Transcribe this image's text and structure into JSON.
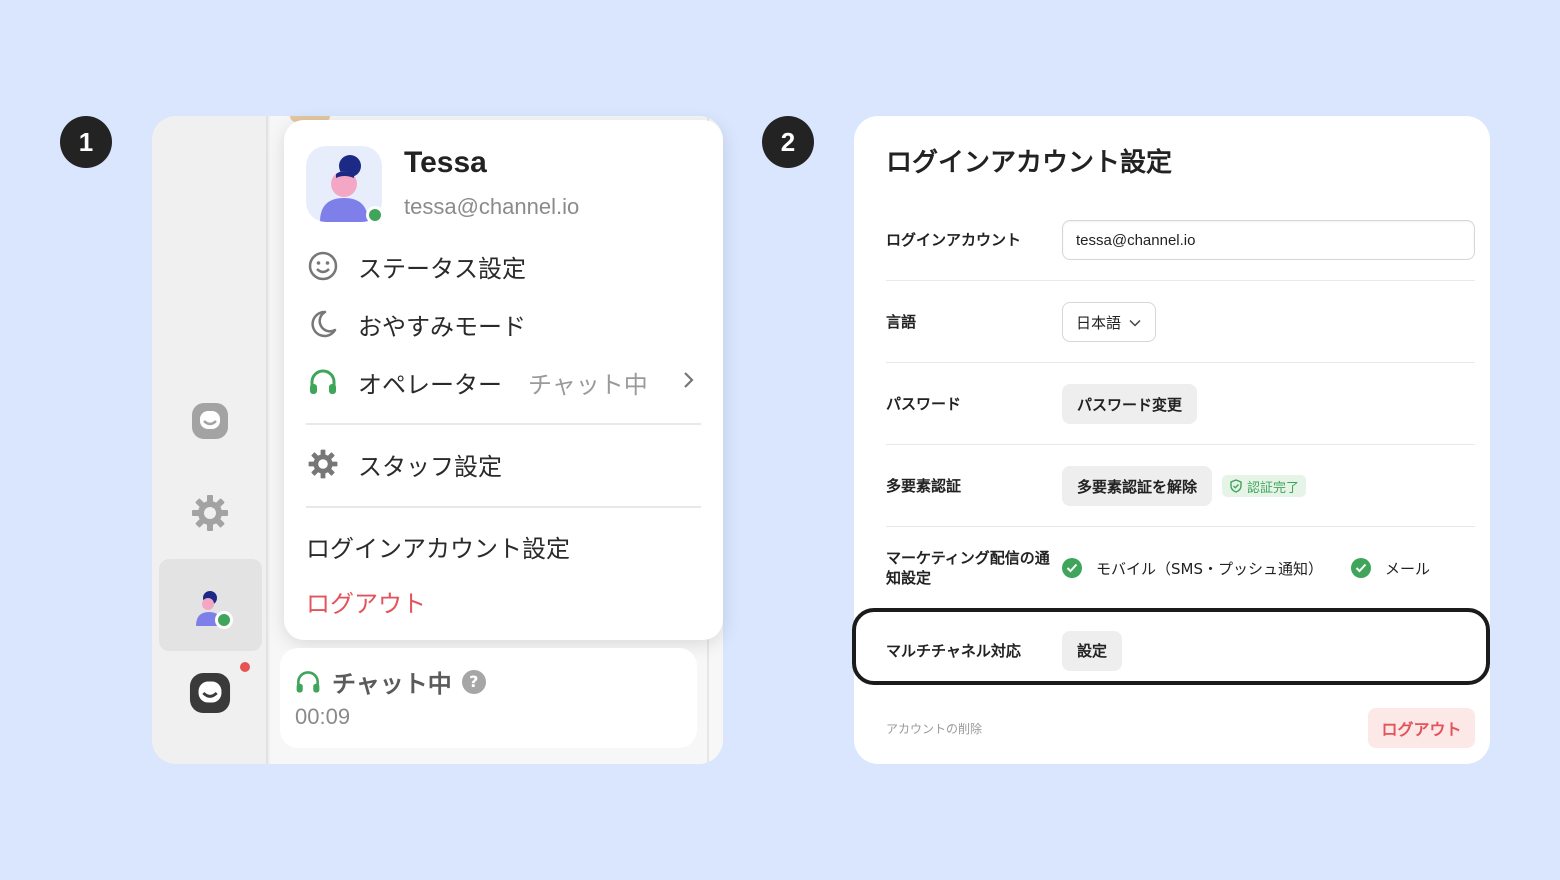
{
  "steps": {
    "one": "1",
    "two": "2"
  },
  "profile_menu": {
    "name": "Tessa",
    "email": "tessa@channel.io",
    "status_setting": "ステータス設定",
    "do_not_disturb": "おやすみモード",
    "operator": "オペレーター",
    "operator_status": "チャット中",
    "staff_settings": "スタッフ設定",
    "login_account_settings": "ログインアカウント設定",
    "logout": "ログアウト"
  },
  "chat_card": {
    "status": "チャット中",
    "help": "?",
    "timer": "00:09"
  },
  "sidebar_icons": [
    "chat-icon",
    "gear-icon",
    "avatar",
    "chat-icon"
  ],
  "settings": {
    "title": "ログインアカウント設定",
    "login_account_label": "ログインアカウント",
    "login_account_value": "tessa@channel.io",
    "language_label": "言語",
    "language_value": "日本語",
    "password_label": "パスワード",
    "password_button": "パスワード変更",
    "mfa_label": "多要素認証",
    "mfa_button": "多要素認証を解除",
    "mfa_badge": "認証完了",
    "marketing_label": "マーケティング配信の通知設定",
    "marketing_mobile": "モバイル（SMS・プッシュ通知）",
    "marketing_mail": "メール",
    "multichannel_label": "マルチチャネル対応",
    "multichannel_button": "設定",
    "delete_account": "アカウントの削除",
    "logout_button": "ログアウト"
  },
  "colors": {
    "background": "#d9e6fd",
    "online": "#3fa55a",
    "danger": "#e2545a",
    "highlight_border": "#1b1b1b"
  }
}
